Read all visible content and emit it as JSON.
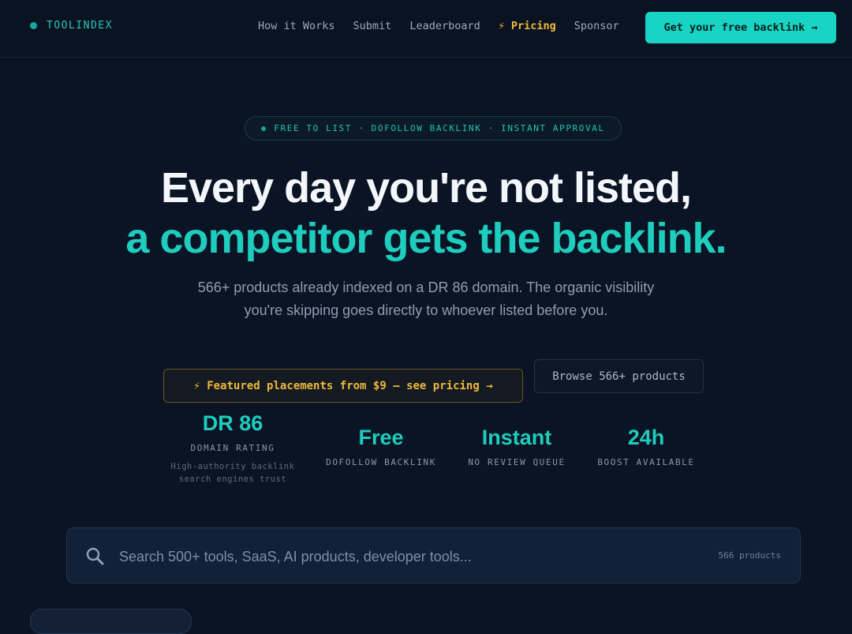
{
  "nav": {
    "brand": "TOOLINDEX",
    "links": [
      "How it Works",
      "Submit",
      "Leaderboard"
    ],
    "pricing": {
      "icon": "⚡",
      "label": "Pricing"
    },
    "sponsor": "Sponsor",
    "cta": "Get your free backlink →"
  },
  "hero": {
    "pill": "FREE TO LIST · DOFOLLOW BACKLINK · INSTANT APPROVAL",
    "headline_line1": "Every day you're not listed,",
    "headline_line2": "a competitor gets the backlink.",
    "sub_line1": "566+ products already indexed on a DR 86 domain. The organic visibility",
    "sub_line2": "you're skipping goes directly to whoever listed before you.",
    "featured_button": "⚡ Featured placements from $9 — see pricing →",
    "browse_button": "Browse 566+ products"
  },
  "stats": [
    {
      "value": "DR 86",
      "label": "DOMAIN RATING",
      "desc_line1": "High-authority backlink",
      "desc_line2": "search engines trust"
    },
    {
      "value": "Free",
      "label": "DOFOLLOW BACKLINK"
    },
    {
      "value": "Instant",
      "label": "NO REVIEW QUEUE"
    },
    {
      "value": "24h",
      "label": "BOOST AVAILABLE"
    }
  ],
  "search": {
    "placeholder": "Search 500+ tools, SaaS, AI products, developer tools...",
    "count": "566 products"
  },
  "colors": {
    "background": "#0b1424",
    "accent_teal": "#1ecdbd",
    "accent_gold": "#f2b73a"
  }
}
